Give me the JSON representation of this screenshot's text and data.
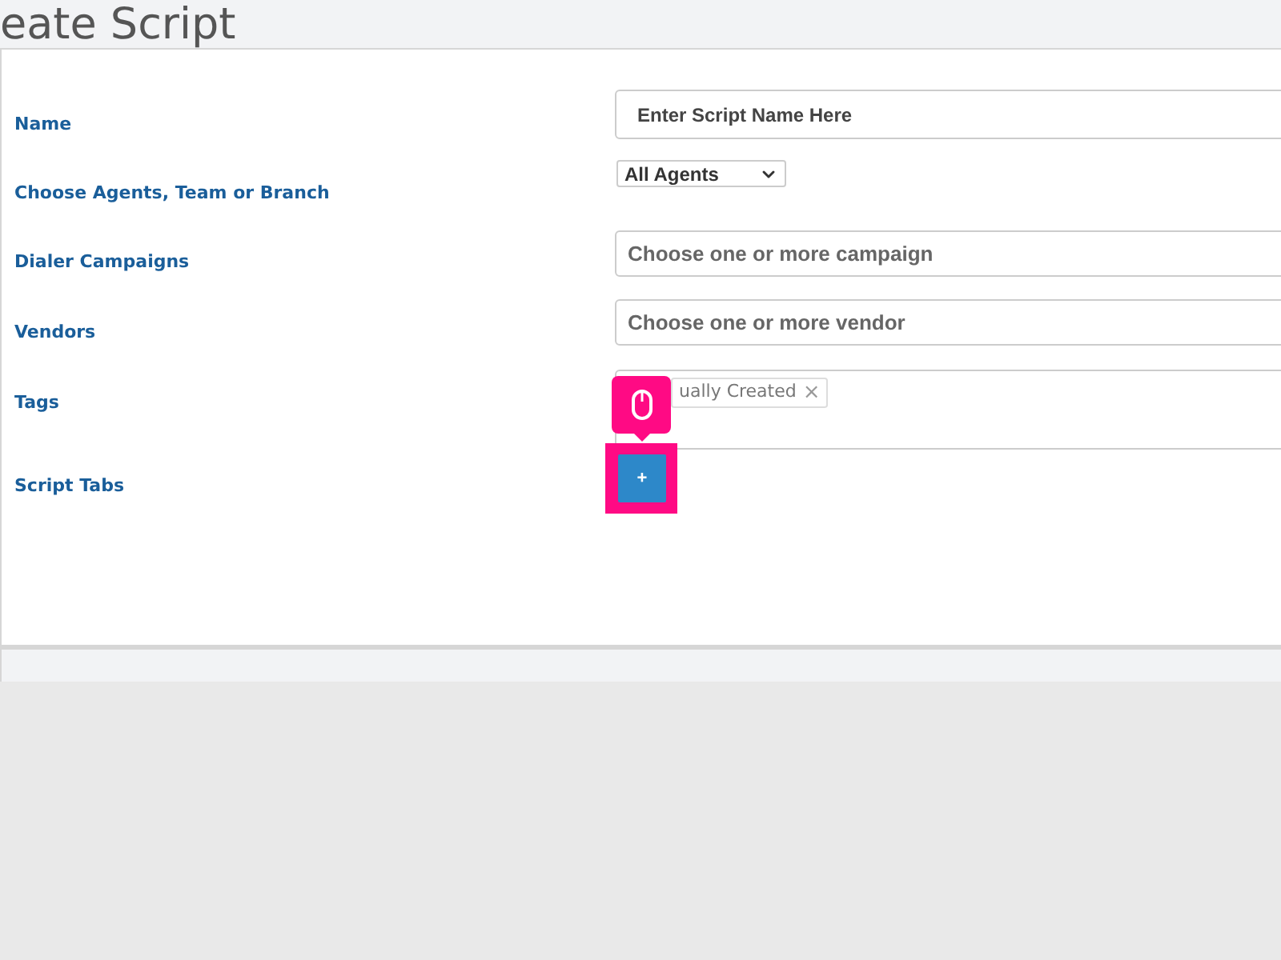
{
  "header": {
    "title": "eate Script"
  },
  "form": {
    "name": {
      "label": "Name",
      "value": "Enter Script Name Here"
    },
    "agents": {
      "label": "Choose Agents, Team or Branch",
      "value": "All Agents"
    },
    "campaigns": {
      "label": "Dialer Campaigns",
      "placeholder": "Choose one or more campaign"
    },
    "vendors": {
      "label": "Vendors",
      "placeholder": "Choose one or more vendor"
    },
    "tags": {
      "label": "Tags",
      "items": [
        {
          "text": "ually Created",
          "remove": "×"
        }
      ]
    },
    "script_tabs": {
      "label": "Script Tabs",
      "add_button": "+",
      "highlighted": true
    }
  }
}
